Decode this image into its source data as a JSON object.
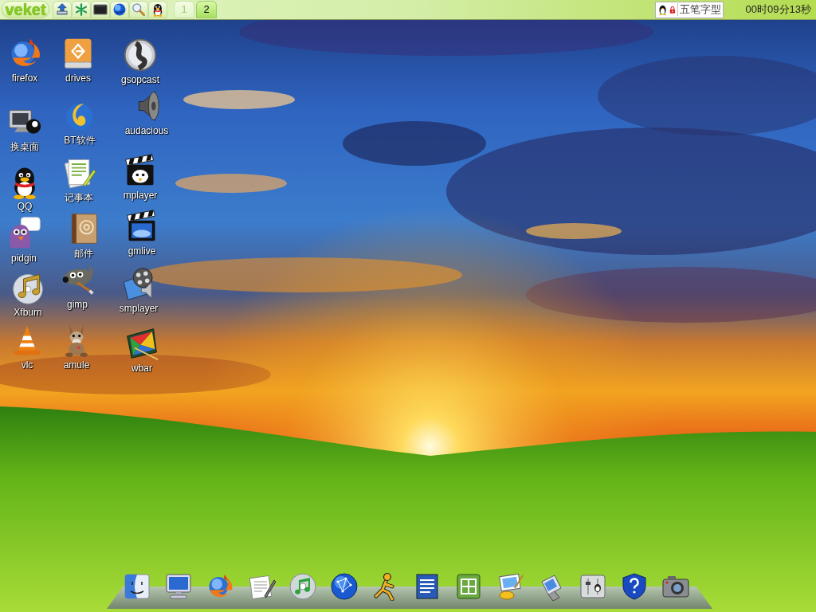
{
  "top_panel": {
    "menu_button": "veket",
    "workspaces": [
      {
        "label": "1",
        "selected": false
      },
      {
        "label": "2",
        "selected": true
      }
    ],
    "input_method": "五笔字型",
    "clock": "00时09分13秒"
  },
  "desktop": {
    "icons": [
      {
        "label": "firefox"
      },
      {
        "label": "换桌面"
      },
      {
        "label": "QQ"
      },
      {
        "label": "pidgin"
      },
      {
        "label": "Xfburn"
      },
      {
        "label": "vlc"
      },
      {
        "label": "drives"
      },
      {
        "label": "BT软件"
      },
      {
        "label": "记事本"
      },
      {
        "label": "邮件"
      },
      {
        "label": "gimp"
      },
      {
        "label": "amule"
      },
      {
        "label": "gsopcast"
      },
      {
        "label": "audacious"
      },
      {
        "label": "mplayer"
      },
      {
        "label": "gmlive"
      },
      {
        "label": "smplayer"
      },
      {
        "label": "wbar"
      }
    ]
  }
}
